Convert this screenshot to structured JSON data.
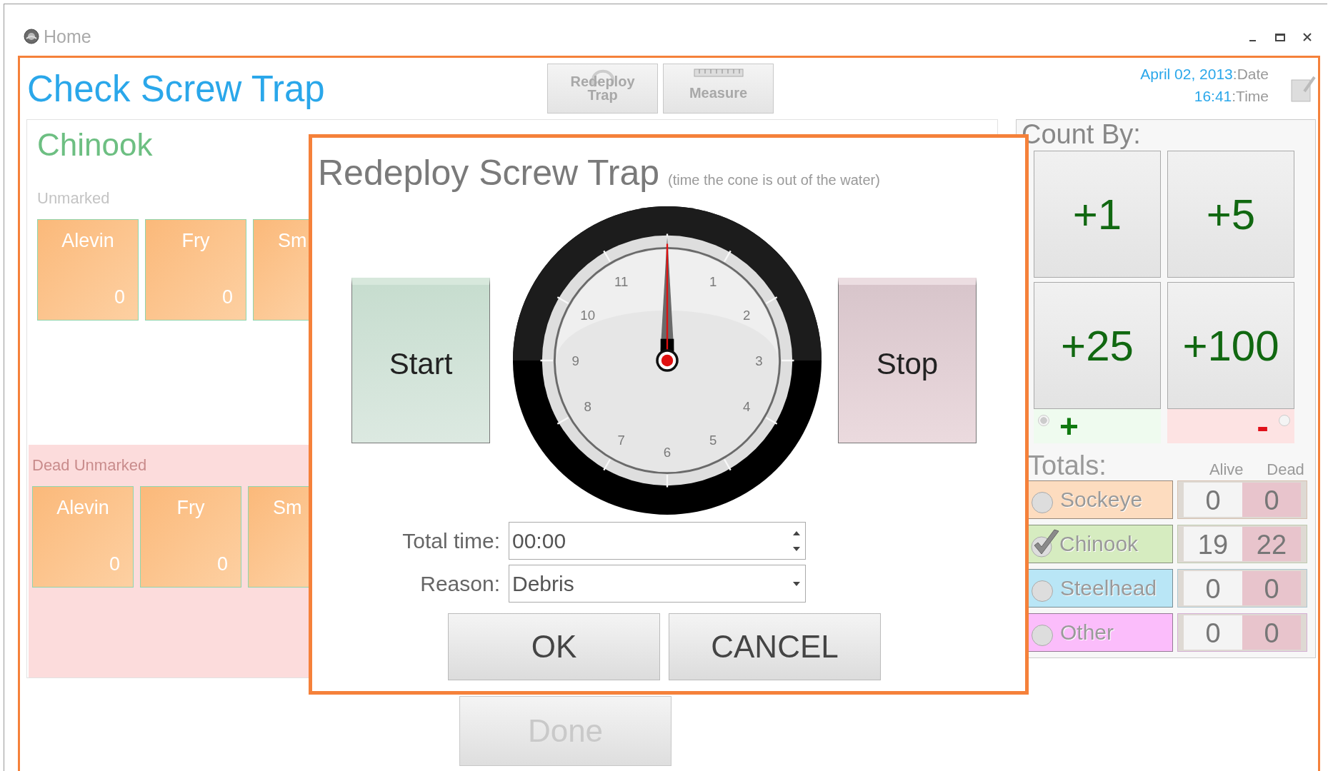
{
  "window": {
    "title": "Home"
  },
  "header": {
    "title": "Check Screw Trap",
    "toolbar": [
      {
        "label": "Redeploy Trap",
        "kind": "redeploy"
      },
      {
        "label": "Measure",
        "kind": "measure"
      }
    ],
    "date": "April 02, 2013",
    "date_label": ":Date",
    "time": "16:41",
    "time_label": ":Time"
  },
  "species_panel": {
    "title": "Chinook",
    "sections": [
      {
        "kind": "live",
        "label": "Unmarked",
        "tiles": [
          {
            "name": "Alevin",
            "count": "0"
          },
          {
            "name": "Fry",
            "count": "0"
          },
          {
            "name": "Sm"
          }
        ]
      },
      {
        "kind": "dead",
        "label": "Dead Unmarked",
        "tiles": [
          {
            "name": "Alevin",
            "count": "0"
          },
          {
            "name": "Fry",
            "count": "0"
          },
          {
            "name": "Sm"
          }
        ]
      }
    ]
  },
  "done_button": {
    "label": "Done",
    "disabled": true
  },
  "count_panel": {
    "title": "Count By:",
    "buttons": [
      "+1",
      "+5",
      "+25",
      "+100"
    ],
    "signs": [
      {
        "label": "+",
        "kind": "plus",
        "selected": true
      },
      {
        "label": "-",
        "kind": "minus",
        "selected": false
      }
    ],
    "totals_title": "Totals:",
    "columns": [
      "Alive",
      "Dead"
    ],
    "rows": [
      {
        "name": "Sockeye",
        "color": "#fddcbf",
        "selected": false,
        "alive": "0",
        "dead": "0"
      },
      {
        "name": "Chinook",
        "color": "#d6ecc0",
        "selected": true,
        "alive": "19",
        "dead": "22"
      },
      {
        "name": "Steelhead",
        "color": "#b9e6f6",
        "selected": false,
        "alive": "0",
        "dead": "0"
      },
      {
        "name": "Other",
        "color": "#fbbdfb",
        "selected": false,
        "alive": "0",
        "dead": "0"
      }
    ]
  },
  "dialog": {
    "title": "Redeploy Screw Trap",
    "subtitle": "(time the cone is out of the water)",
    "start_label": "Start",
    "stop_label": "Stop",
    "dial_numbers": [
      "1",
      "2",
      "3",
      "4",
      "5",
      "6",
      "7",
      "8",
      "9",
      "10",
      "11"
    ],
    "total_time_label": "Total time:",
    "total_time": "00:00",
    "reason_label": "Reason:",
    "reason": "Debris",
    "buttons": [
      "OK",
      "CANCEL"
    ]
  }
}
